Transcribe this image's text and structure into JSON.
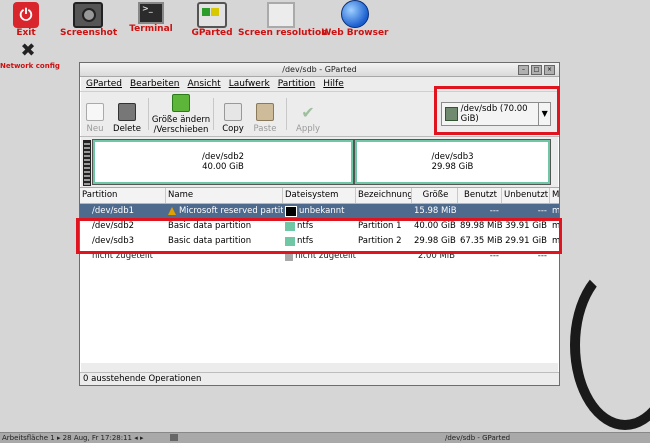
{
  "desktop": {
    "icons": [
      {
        "label": "Exit"
      },
      {
        "label": "Screenshot"
      },
      {
        "label": "Terminal"
      },
      {
        "label": "GParted"
      },
      {
        "label": "Screen resolution"
      },
      {
        "label": "Web Browser"
      },
      {
        "label": "Network config"
      }
    ]
  },
  "window": {
    "title": "/dev/sdb - GParted",
    "menu": [
      "GParted",
      "Bearbeiten",
      "Ansicht",
      "Laufwerk",
      "Partition",
      "Hilfe"
    ],
    "toolbar": {
      "new": "Neu",
      "delete": "Delete",
      "resize": "Größe ändern\n/Verschieben",
      "copy": "Copy",
      "paste": "Paste",
      "apply": "Apply"
    },
    "device": "/dev/sdb  (70.00 GiB)",
    "graph": {
      "p2": {
        "name": "/dev/sdb2",
        "size": "40.00 GiB"
      },
      "p3": {
        "name": "/dev/sdb3",
        "size": "29.98 GiB"
      }
    },
    "columns": [
      "Partition",
      "Name",
      "Dateisystem",
      "Bezeichnung",
      "Größe",
      "Benutzt",
      "Unbenutzt",
      "M"
    ],
    "rows": [
      {
        "partition": "/dev/sdb1",
        "name": "Microsoft reserved partition",
        "fs": "unbekannt",
        "label": "",
        "size": "15.98 MiB",
        "used": "---",
        "unused": "---",
        "flags": "m",
        "fs_color": "#000000"
      },
      {
        "partition": "/dev/sdb2",
        "name": "Basic data partition",
        "fs": "ntfs",
        "label": "Partition 1",
        "size": "40.00 GiB",
        "used": "89.98 MiB",
        "unused": "39.91 GiB",
        "flags": "m",
        "fs_color": "#6fc7a5"
      },
      {
        "partition": "/dev/sdb3",
        "name": "Basic data partition",
        "fs": "ntfs",
        "label": "Partition 2",
        "size": "29.98 GiB",
        "used": "67.35 MiB",
        "unused": "29.91 GiB",
        "flags": "m",
        "fs_color": "#6fc7a5"
      },
      {
        "partition": "nicht zugeteilt",
        "name": "",
        "fs": "nicht zugeteilt",
        "label": "",
        "size": "2.00 MiB",
        "used": "---",
        "unused": "---",
        "flags": "",
        "fs_color": "#a8a8a8"
      }
    ],
    "status": "0 ausstehende Operationen"
  },
  "taskbar": {
    "left": "Arbeitsfläche 1 ▸   28 Aug, Fr 17:28:11   ◂ ▸",
    "window": "/dev/sdb - GParted"
  },
  "colors": {
    "highlight": "#e0141e",
    "selection": "#4e6a8c",
    "ntfs": "#6fc7a5"
  }
}
